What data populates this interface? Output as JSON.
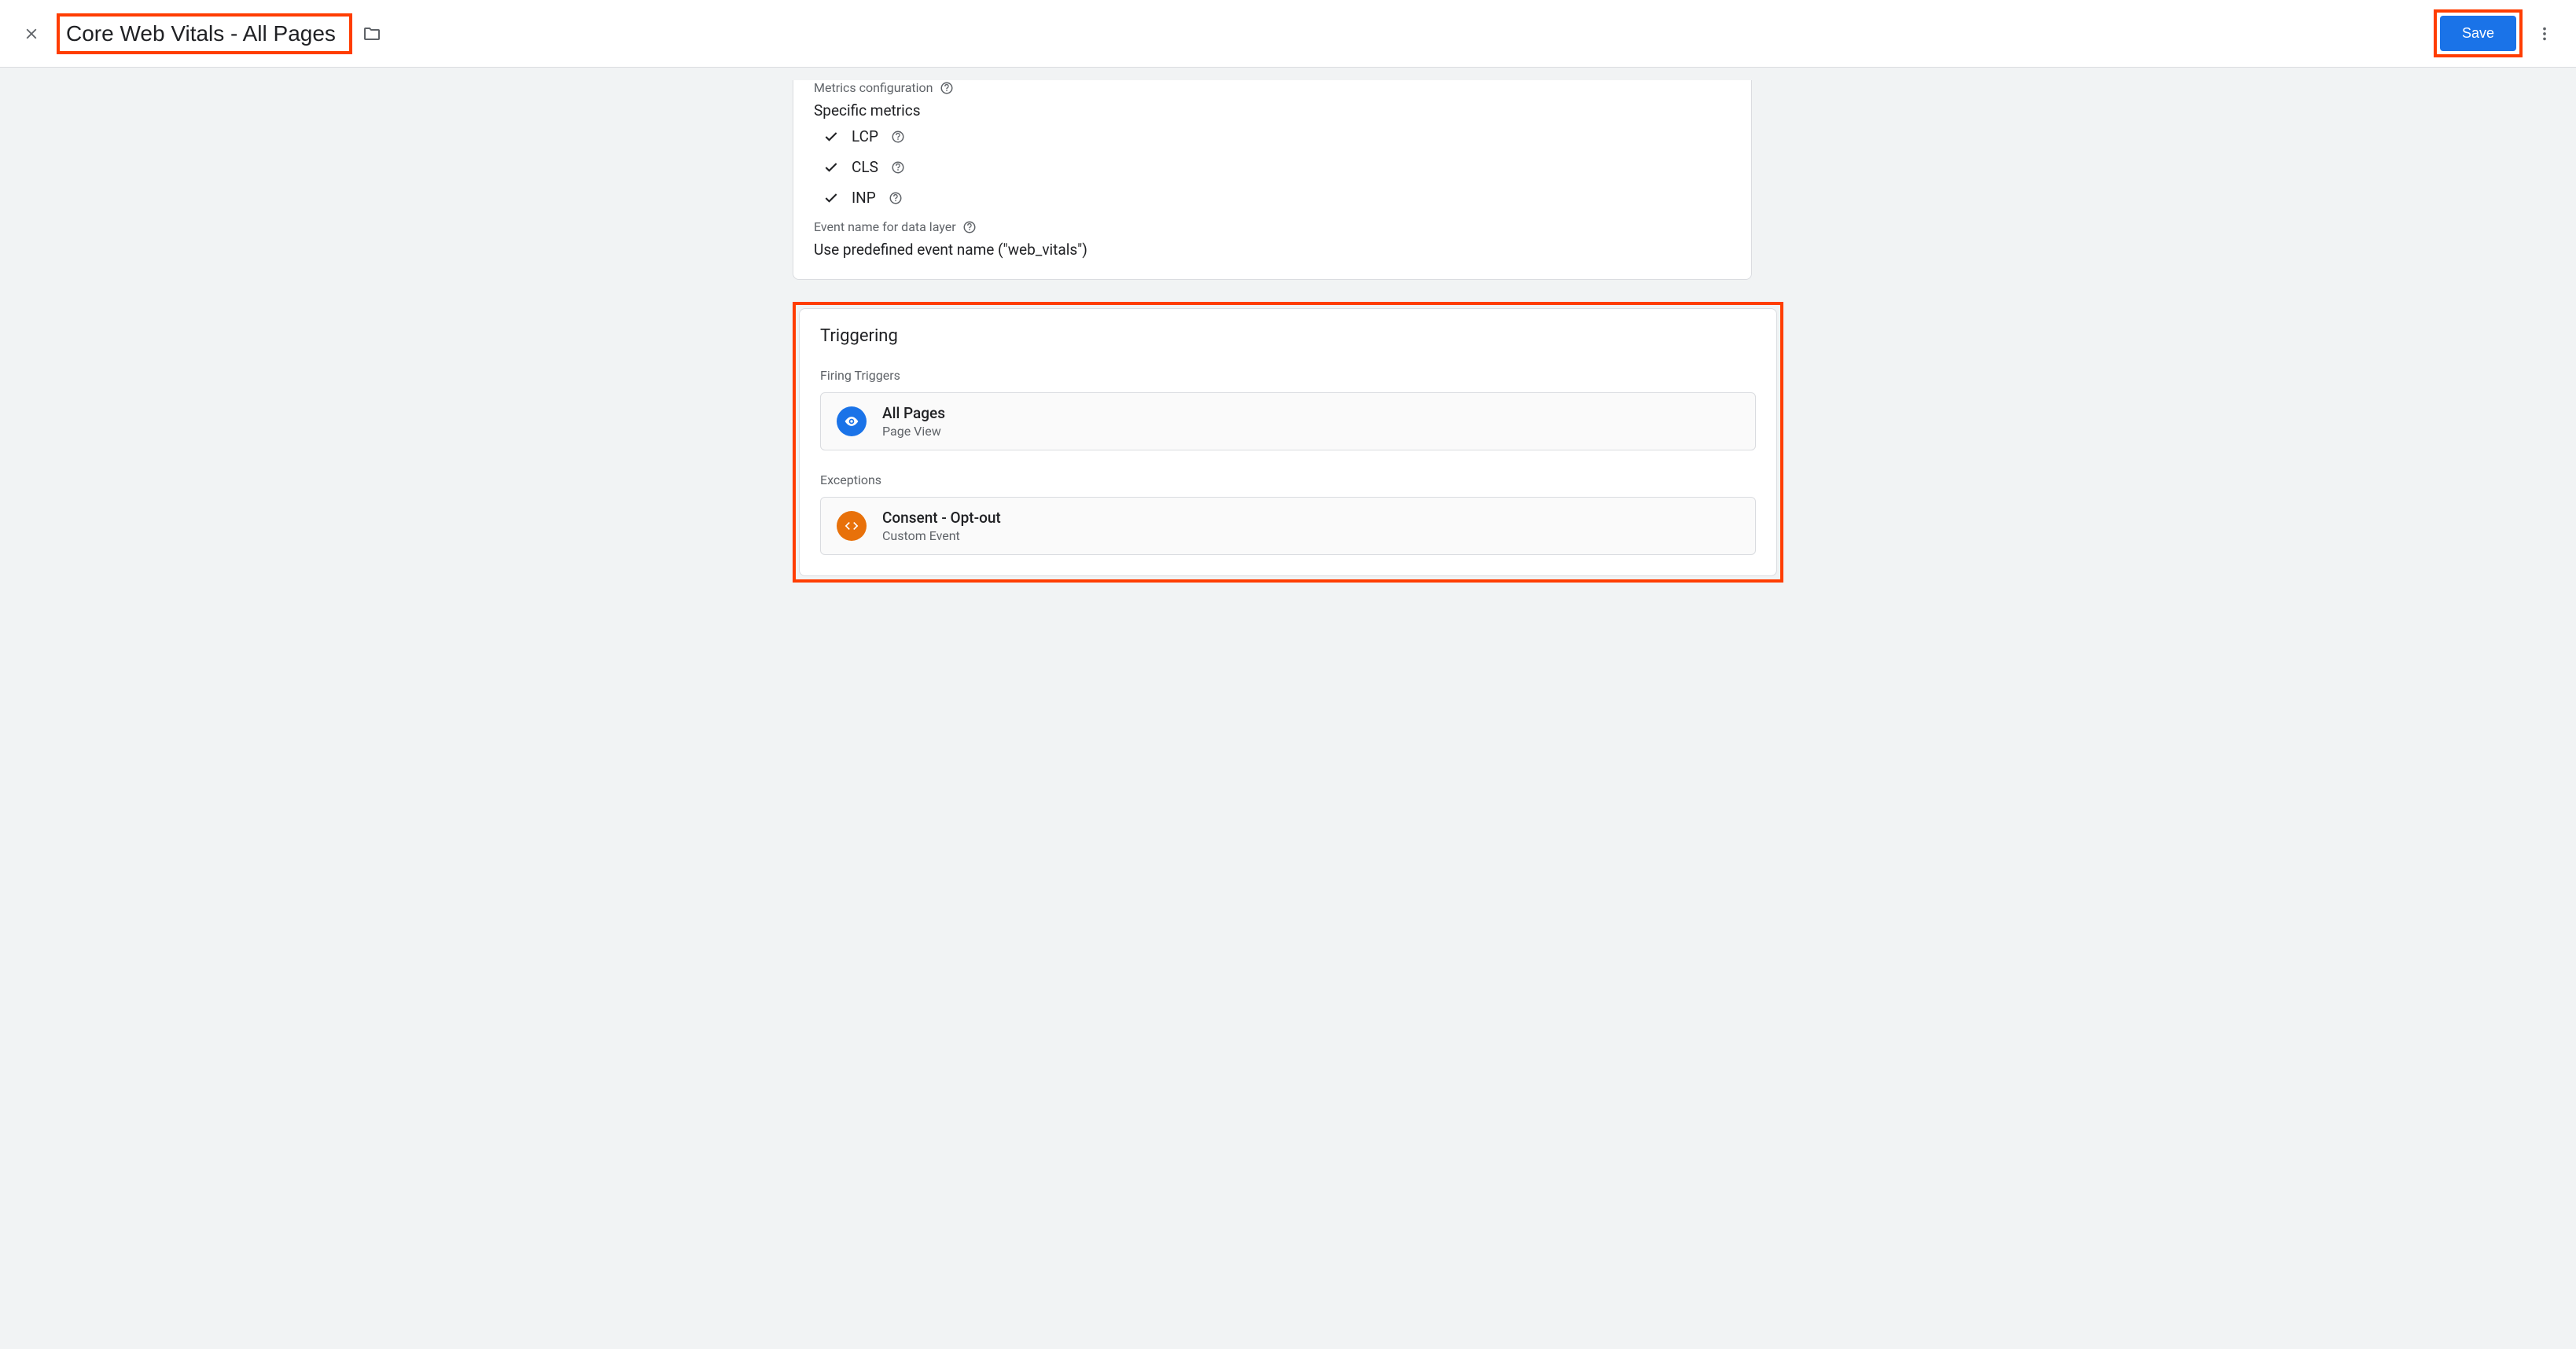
{
  "header": {
    "title": "Core Web Vitals - All Pages",
    "save_label": "Save"
  },
  "config": {
    "metrics_label": "Metrics configuration",
    "metrics_value": "Specific metrics",
    "metrics": [
      {
        "name": "LCP"
      },
      {
        "name": "CLS"
      },
      {
        "name": "INP"
      }
    ],
    "event_label": "Event name for data layer",
    "event_value": "Use predefined event name (\"web_vitals\")"
  },
  "triggering": {
    "title": "Triggering",
    "firing_label": "Firing Triggers",
    "firing": [
      {
        "title": "All Pages",
        "type": "Page View"
      }
    ],
    "exceptions_label": "Exceptions",
    "exceptions": [
      {
        "title": "Consent - Opt-out",
        "type": "Custom Event"
      }
    ]
  }
}
